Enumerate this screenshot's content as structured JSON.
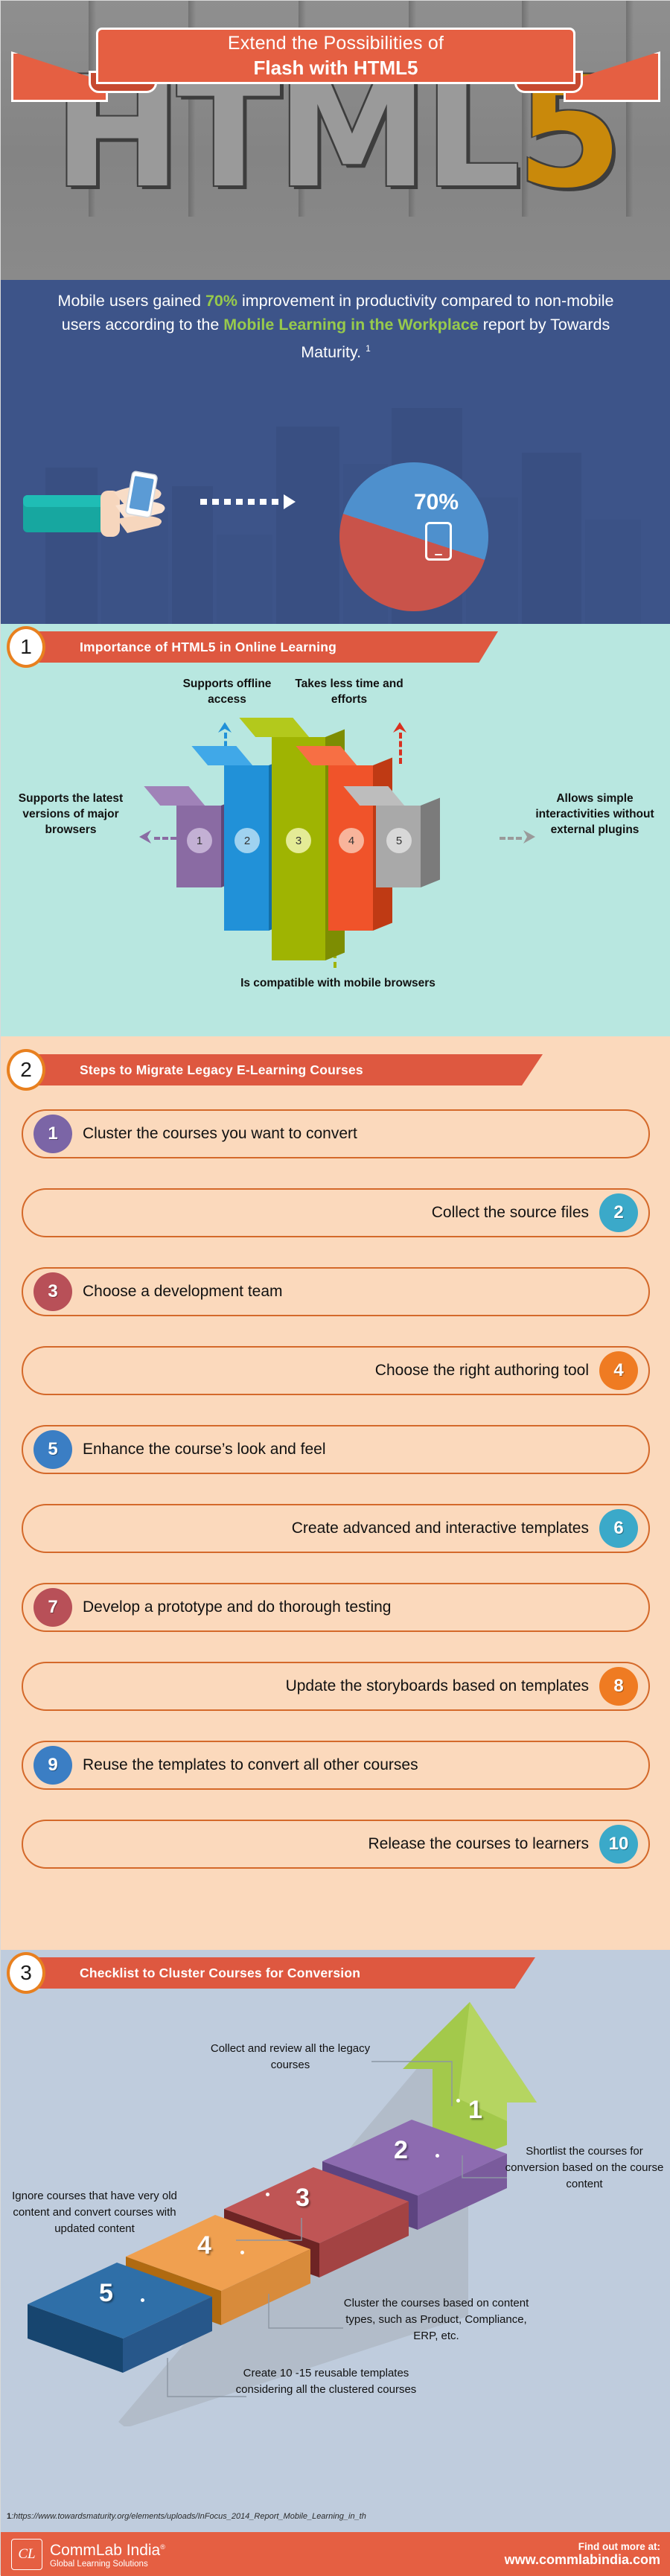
{
  "header": {
    "title_line1": "Extend the Possibilities of",
    "title_line2": "Flash with HTML5",
    "background_word": "HTML",
    "background_word_accent": "5"
  },
  "stat": {
    "text_part1": "Mobile users gained ",
    "highlight1": "70%",
    "text_part2": " improvement in productivity compared to non-mobile users according to the ",
    "highlight2": "Mobile Learning in the Workplace",
    "text_part3": " report by Towards Maturity. ",
    "footnote_marker": "1",
    "pie_label": "70%",
    "phone_icon": "mobile-phone-icon"
  },
  "section1": {
    "number": "1",
    "title": "Importance of HTML5 in Online Learning",
    "chart_data": {
      "type": "bar",
      "title": "Importance of HTML5 in Online Learning",
      "categories": [
        "1",
        "2",
        "3",
        "4",
        "5"
      ],
      "values": [
        1,
        2,
        3,
        2,
        1
      ],
      "labels": [
        "Supports the latest versions of major browsers",
        "Supports offline access",
        "Is compatible with mobile browsers",
        "Takes less time and efforts",
        "Allows simple interactivities without external plugins"
      ],
      "colors": [
        "#8a6ba3",
        "#2191d8",
        "#9fb402",
        "#f0532a",
        "#a9a9a9"
      ],
      "xlabel": "",
      "ylabel": "",
      "grid": false,
      "legend": "none"
    },
    "labels": {
      "left": "Supports the latest versions of major browsers",
      "top_left": "Supports offline access",
      "top_right": "Takes less time and efforts",
      "right": "Allows simple interactivities without external plugins",
      "bottom": "Is compatible with mobile browsers"
    },
    "bar_numbers": [
      "1",
      "2",
      "3",
      "4",
      "5"
    ]
  },
  "section2": {
    "number": "2",
    "title": "Steps to Migrate Legacy E-Learning Courses",
    "steps": [
      {
        "num": "1",
        "text": "Cluster the courses you want to convert",
        "side": "l",
        "color": "#7b65a6"
      },
      {
        "num": "2",
        "text": "Collect the source files",
        "side": "r",
        "color": "#3ba9c9"
      },
      {
        "num": "3",
        "text": "Choose a development team",
        "side": "l",
        "color": "#b85058"
      },
      {
        "num": "4",
        "text": "Choose the right authoring tool",
        "side": "r",
        "color": "#ef7b22"
      },
      {
        "num": "5",
        "text": "Enhance the course’s look and feel",
        "side": "l",
        "color": "#3b7ec4"
      },
      {
        "num": "6",
        "text": "Create advanced and interactive templates",
        "side": "r",
        "color": "#3ba9c9"
      },
      {
        "num": "7",
        "text": "Develop a prototype and do thorough testing",
        "side": "l",
        "color": "#b85058"
      },
      {
        "num": "8",
        "text": "Update the storyboards based on templates",
        "side": "r",
        "color": "#ef7b22"
      },
      {
        "num": "9",
        "text": "Reuse the templates to convert all other courses",
        "side": "l",
        "color": "#3b7ec4"
      },
      {
        "num": "10",
        "text": "Release the courses to learners",
        "side": "r",
        "color": "#3ba9c9"
      }
    ]
  },
  "section3": {
    "number": "3",
    "title": "Checklist to Cluster Courses for Conversion",
    "steps": [
      {
        "num": "1",
        "color": "#a3c martinez",
        "label": "Collect and review all the legacy courses"
      },
      {
        "num": "2",
        "label": "Shortlist the courses for conversion based on the course content"
      },
      {
        "num": "3",
        "label": "Ignore courses that have very old content and convert courses with updated content"
      },
      {
        "num": "4",
        "label": "Cluster the courses based on content types, such as Product, Compliance, ERP, etc."
      },
      {
        "num": "5",
        "label": "Create 10 -15 reusable templates considering all the clustered courses"
      }
    ],
    "labels": {
      "one": "Collect and review all the legacy courses",
      "two": "Shortlist the courses for conversion based on the course content",
      "three": "Ignore courses that have very old content and convert courses with updated content",
      "four": "Cluster the courses based on content types, such as Product, Compliance, ERP, etc.",
      "five": "Create 10 -15 reusable templates considering all the clustered courses"
    },
    "numbers": [
      "1",
      "2",
      "3",
      "4",
      "5"
    ]
  },
  "source": {
    "marker": "1",
    "url": ":https://www.towardsmaturity.org/elements/uploads/InFocus_2014_Report_Mobile_Learning_in_th"
  },
  "footer": {
    "logo_mark": "CL",
    "brand": "CommLab India",
    "brand_reg": "®",
    "tagline": "Global Learning Solutions",
    "cta": "Find out more at:",
    "website": "www.commlabindia.com"
  },
  "colors": {
    "accent_red": "#e55f42",
    "banner_red": "#de5840",
    "banner_ring": "#e8801f",
    "blue_bg": "#3d5489",
    "teal_bg": "#b8e7e0",
    "peach_bg": "#fbd9bc",
    "steel_bg": "#bfccdd",
    "green_hl": "#97ca4c"
  }
}
